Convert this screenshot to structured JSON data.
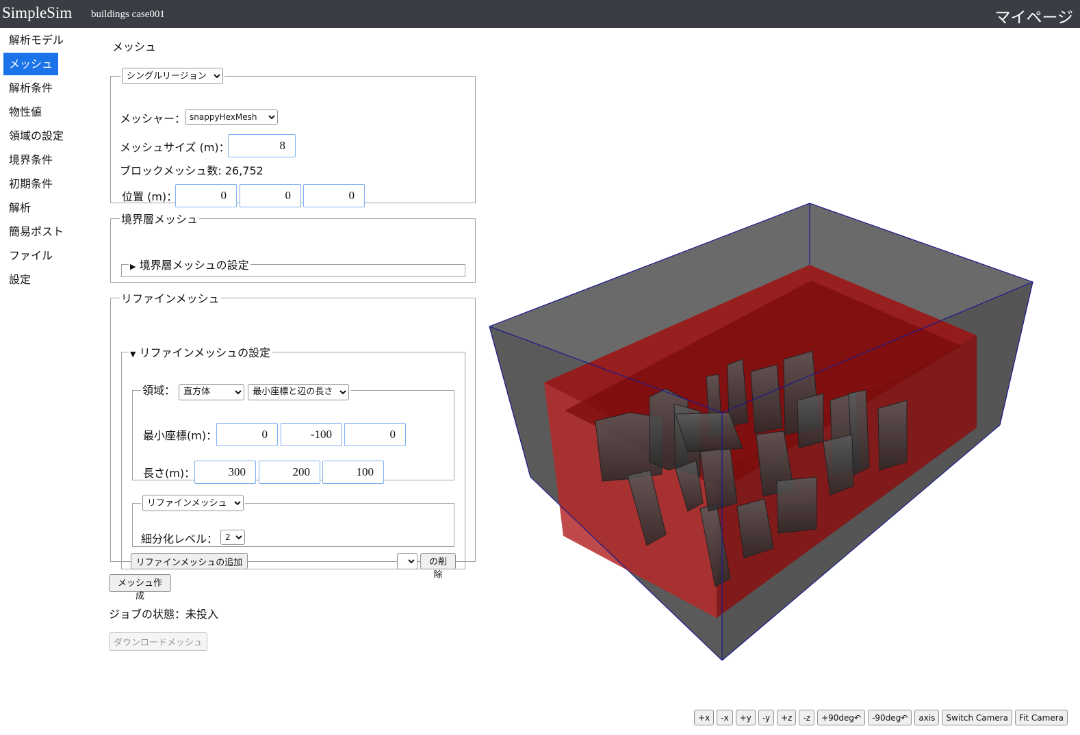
{
  "app": {
    "brand": "SimpleSim",
    "case_name": "buildings case001",
    "mypage": "マイページ"
  },
  "sidebar": {
    "items": [
      {
        "label": "解析モデル"
      },
      {
        "label": "メッシュ",
        "active": true
      },
      {
        "label": "解析条件"
      },
      {
        "label": "物性値"
      },
      {
        "label": "領域の設定"
      },
      {
        "label": "境界条件"
      },
      {
        "label": "初期条件"
      },
      {
        "label": "解析"
      },
      {
        "label": "簡易ポスト"
      },
      {
        "label": "ファイル"
      },
      {
        "label": "設定"
      }
    ]
  },
  "main": {
    "title": "メッシュ",
    "region": {
      "select": "シングルリージョン",
      "mesher_label": "メッシャー：",
      "mesher_value": "snappyHexMesh",
      "size_label": "メッシュサイズ (m)：",
      "size_value": "8",
      "block_label": "ブロックメッシュ数: 26,752",
      "position_label": "位置 (m)：",
      "position": [
        "0",
        "0",
        "0"
      ]
    },
    "boundary_layer": {
      "legend": "境界層メッシュ",
      "summary": "境界層メッシュの設定"
    },
    "refine": {
      "legend": "リファインメッシュ",
      "summary": "リファインメッシュの設定",
      "area_label": "領域：",
      "shape": "直方体",
      "spec": "最小座標と辺の長さ",
      "min_label": "最小座標(m)：",
      "min": [
        "0",
        "-100",
        "0"
      ],
      "length_label": "長さ(m)：",
      "length": [
        "300",
        "200",
        "100"
      ],
      "type": "リファインメッシュ",
      "level_label": "細分化レベル：",
      "level": "2",
      "add_button": "リファインメッシュの追加",
      "delete_button": "の削除"
    },
    "create_button": "メッシュ作成",
    "job_status": "ジョブの状態：未投入",
    "download_button": "ダウンロードメッシュ"
  },
  "viewer": {
    "colors": {
      "domain": "#5a5a5a",
      "refine": "#b00000",
      "edge": "#1a1a8c"
    },
    "toolbar": [
      "+x",
      "-x",
      "+y",
      "-y",
      "+z",
      "-z",
      "+90deg↶",
      "-90deg↶",
      "axis",
      "Switch Camera",
      "Fit Camera"
    ]
  }
}
